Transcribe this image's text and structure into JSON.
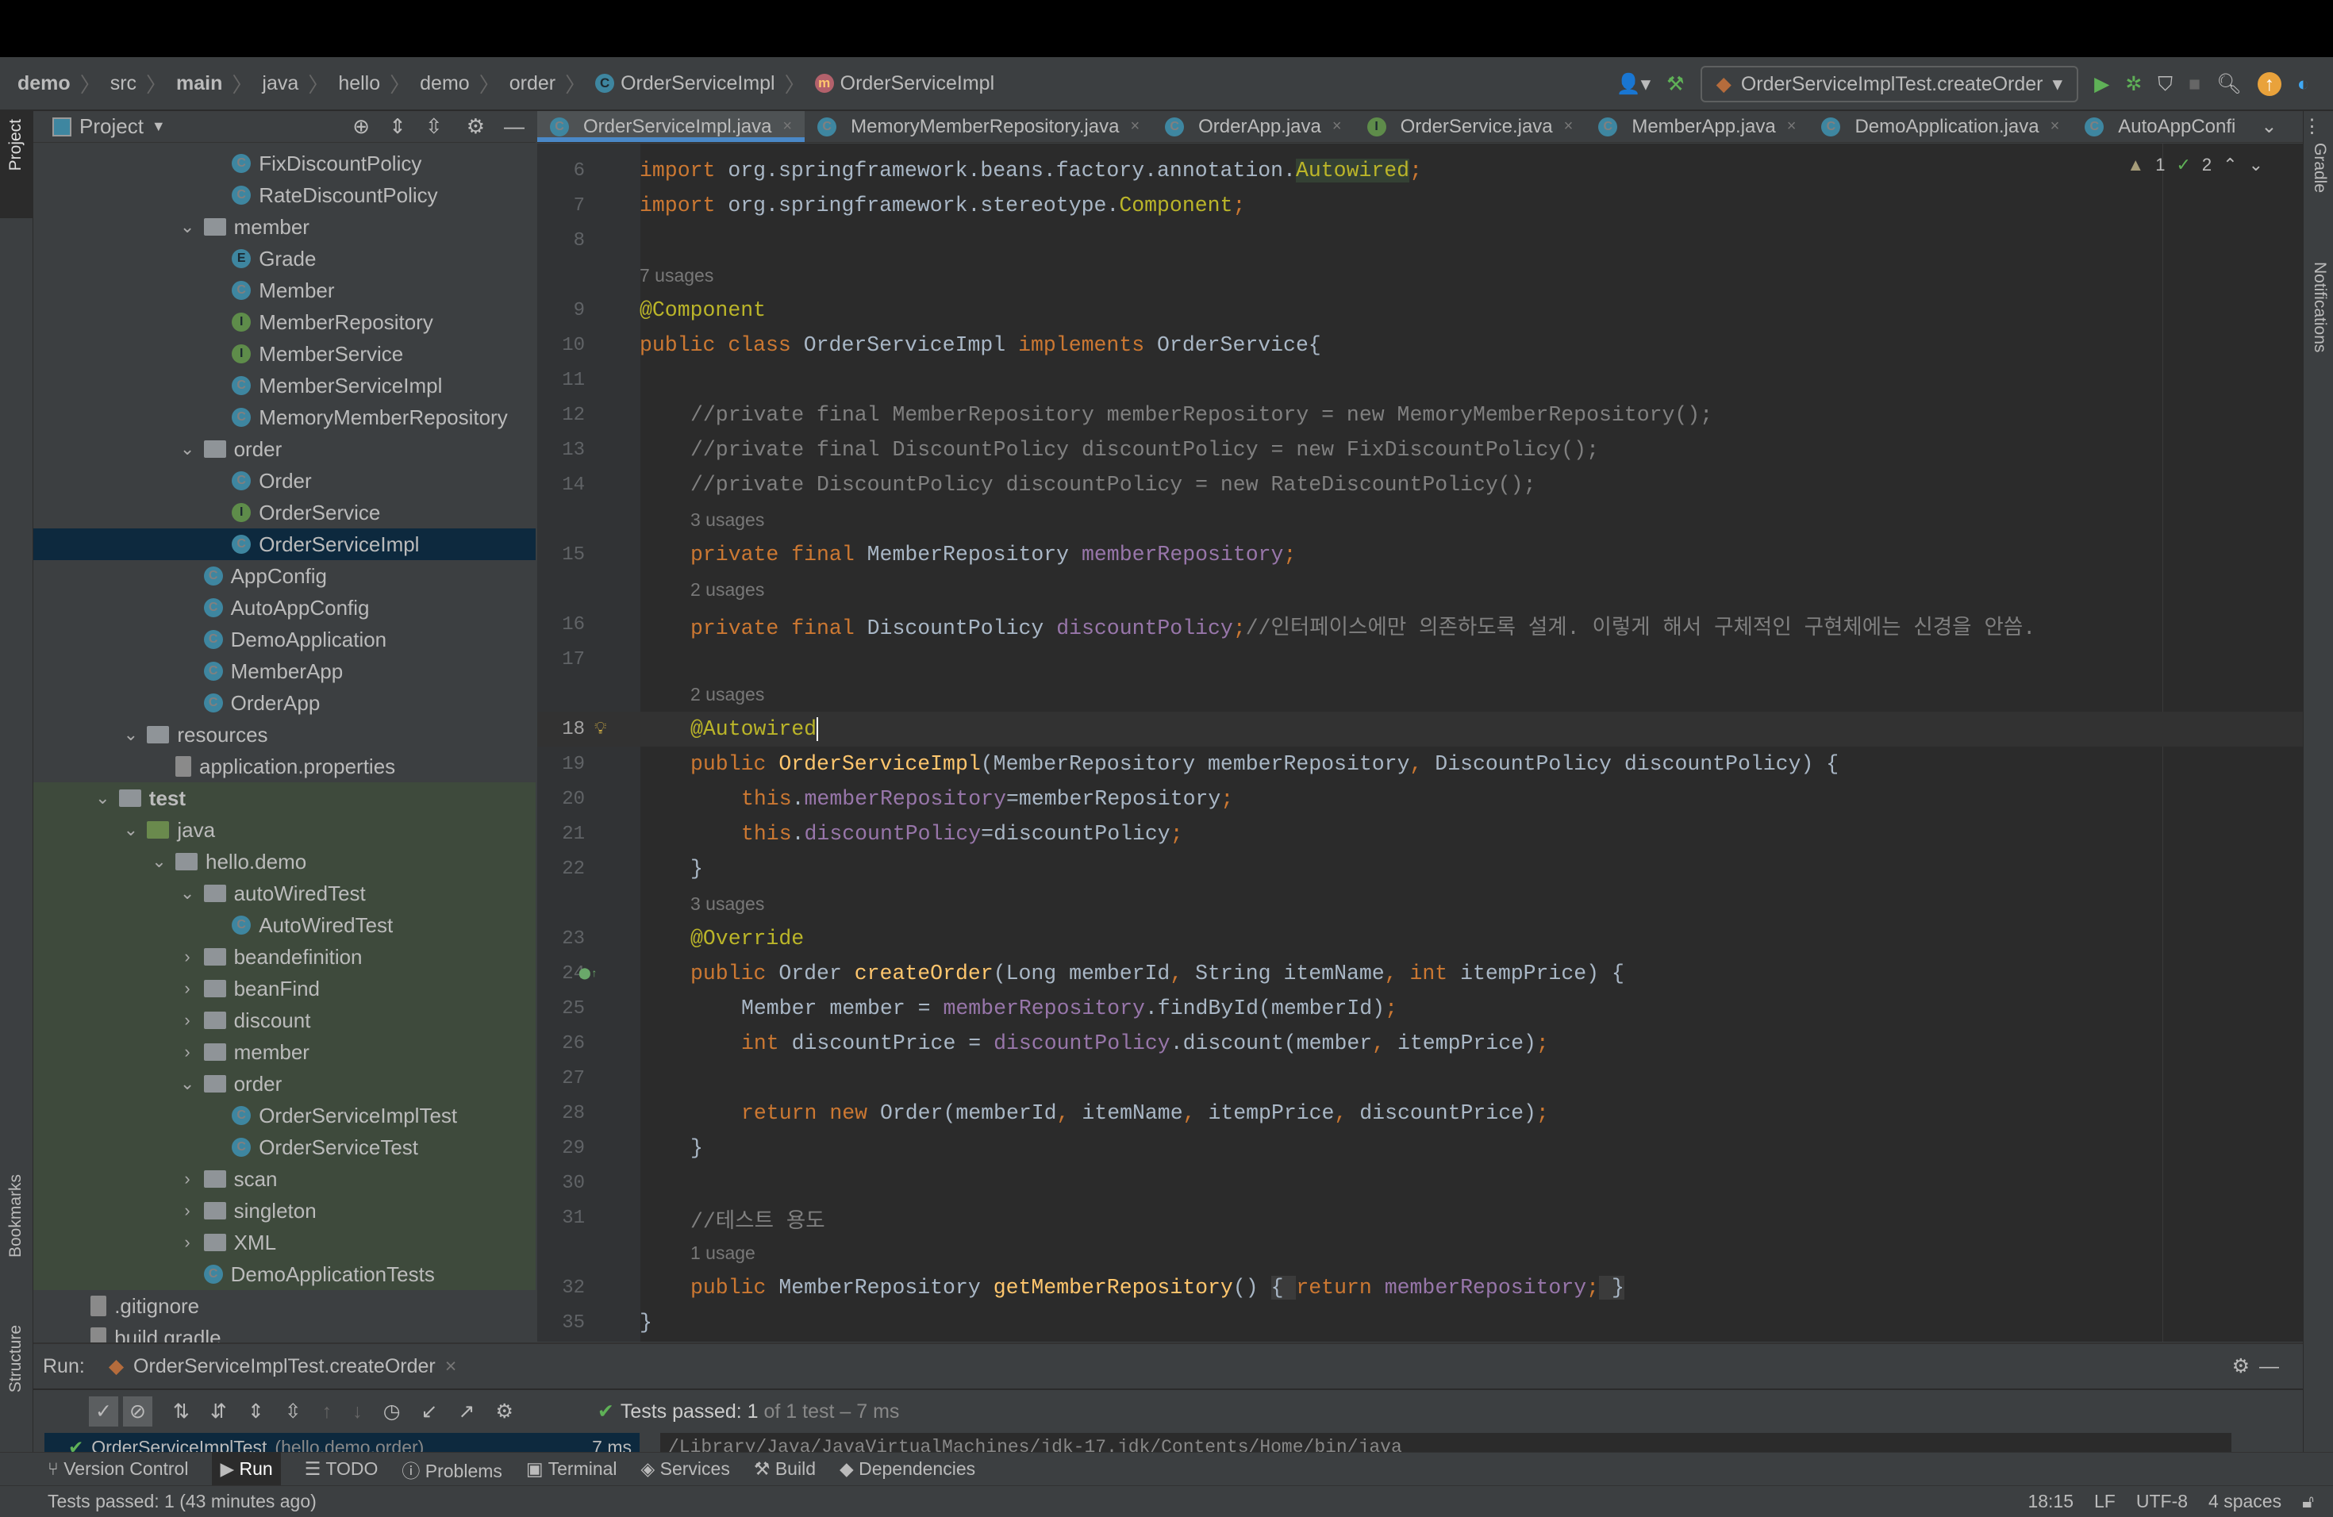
{
  "breadcrumb": [
    "demo",
    "src",
    "main",
    "java",
    "hello",
    "demo",
    "order",
    "OrderServiceImpl",
    "OrderServiceImpl"
  ],
  "run_config": "OrderServiceImplTest.createOrder",
  "project_header": "Project",
  "left_strip": {
    "project": "Project",
    "bookmarks": "Bookmarks",
    "structure": "Structure"
  },
  "right_strip": {
    "gradle": "Gradle",
    "notifications": "Notifications"
  },
  "tree": [
    {
      "l": 7,
      "t": "c",
      "label": "FixDiscountPolicy"
    },
    {
      "l": 7,
      "t": "c",
      "label": "RateDiscountPolicy"
    },
    {
      "l": 6,
      "t": "folder",
      "label": "member",
      "open": true
    },
    {
      "l": 7,
      "t": "e",
      "label": "Grade"
    },
    {
      "l": 7,
      "t": "c",
      "label": "Member"
    },
    {
      "l": 7,
      "t": "i",
      "label": "MemberRepository"
    },
    {
      "l": 7,
      "t": "i",
      "label": "MemberService"
    },
    {
      "l": 7,
      "t": "c",
      "label": "MemberServiceImpl"
    },
    {
      "l": 7,
      "t": "c",
      "label": "MemoryMemberRepository"
    },
    {
      "l": 6,
      "t": "folder",
      "label": "order",
      "open": true
    },
    {
      "l": 7,
      "t": "c",
      "label": "Order"
    },
    {
      "l": 7,
      "t": "i",
      "label": "OrderService"
    },
    {
      "l": 7,
      "t": "c",
      "label": "OrderServiceImpl",
      "sel": true
    },
    {
      "l": 6,
      "t": "c",
      "label": "AppConfig"
    },
    {
      "l": 6,
      "t": "c",
      "label": "AutoAppConfig"
    },
    {
      "l": 6,
      "t": "c",
      "label": "DemoApplication"
    },
    {
      "l": 6,
      "t": "c",
      "label": "MemberApp"
    },
    {
      "l": 6,
      "t": "c",
      "label": "OrderApp"
    },
    {
      "l": 4,
      "t": "folder",
      "label": "resources",
      "open": true
    },
    {
      "l": 5,
      "t": "file",
      "label": "application.properties"
    },
    {
      "l": 3,
      "t": "folder",
      "label": "test",
      "open": true,
      "g": true,
      "bold": true
    },
    {
      "l": 4,
      "t": "gfolder",
      "label": "java",
      "open": true,
      "g": true
    },
    {
      "l": 5,
      "t": "folder",
      "label": "hello.demo",
      "open": true,
      "g": true
    },
    {
      "l": 6,
      "t": "folder",
      "label": "autoWiredTest",
      "open": true,
      "g": true
    },
    {
      "l": 7,
      "t": "c",
      "label": "AutoWiredTest",
      "g": true
    },
    {
      "l": 6,
      "t": "folder",
      "label": "beandefinition",
      "open": false,
      "g": true
    },
    {
      "l": 6,
      "t": "folder",
      "label": "beanFind",
      "open": false,
      "g": true
    },
    {
      "l": 6,
      "t": "folder",
      "label": "discount",
      "open": false,
      "g": true
    },
    {
      "l": 6,
      "t": "folder",
      "label": "member",
      "open": false,
      "g": true
    },
    {
      "l": 6,
      "t": "folder",
      "label": "order",
      "open": true,
      "g": true
    },
    {
      "l": 7,
      "t": "c",
      "label": "OrderServiceImplTest",
      "g": true
    },
    {
      "l": 7,
      "t": "c",
      "label": "OrderServiceTest",
      "g": true
    },
    {
      "l": 6,
      "t": "folder",
      "label": "scan",
      "open": false,
      "g": true
    },
    {
      "l": 6,
      "t": "folder",
      "label": "singleton",
      "open": false,
      "g": true
    },
    {
      "l": 6,
      "t": "folder",
      "label": "XML",
      "open": false,
      "g": true
    },
    {
      "l": 6,
      "t": "c",
      "label": "DemoApplicationTests",
      "g": true
    },
    {
      "l": 2,
      "t": "file",
      "label": ".gitignore"
    },
    {
      "l": 2,
      "t": "file",
      "label": "build.gradle"
    }
  ],
  "tabs": [
    {
      "label": "OrderServiceImpl.java",
      "t": "c",
      "active": true
    },
    {
      "label": "MemoryMemberRepository.java",
      "t": "c"
    },
    {
      "label": "OrderApp.java",
      "t": "c"
    },
    {
      "label": "OrderService.java",
      "t": "i"
    },
    {
      "label": "MemberApp.java",
      "t": "c"
    },
    {
      "label": "DemoApplication.java",
      "t": "c"
    },
    {
      "label": "AutoAppConfi",
      "t": "c",
      "noclose": true
    }
  ],
  "inspections": {
    "warnings": "1",
    "typos": "2"
  },
  "code": [
    {
      "n": "6",
      "tk": [
        [
          "k",
          "import "
        ],
        [
          "d",
          "org.springframework.beans.factory.annotation."
        ],
        [
          "a hl",
          "Autowired"
        ],
        [
          "k",
          ";"
        ]
      ]
    },
    {
      "n": "7",
      "tk": [
        [
          "k",
          "import "
        ],
        [
          "d",
          "org.springframework.stereotype."
        ],
        [
          "a",
          "Component"
        ],
        [
          "k",
          ";"
        ]
      ]
    },
    {
      "n": "8",
      "tk": []
    },
    {
      "hint": "7 usages",
      "i": 0
    },
    {
      "n": "9",
      "tk": [
        [
          "a",
          "@Component"
        ]
      ]
    },
    {
      "n": "10",
      "tk": [
        [
          "k",
          "public class "
        ],
        [
          "d",
          "OrderServiceImpl "
        ],
        [
          "k",
          "implements "
        ],
        [
          "d",
          "OrderService{"
        ]
      ]
    },
    {
      "n": "11",
      "tk": []
    },
    {
      "n": "12",
      "i": 1,
      "tk": [
        [
          "c",
          "//private final MemberRepository memberRepository = new MemoryMemberRepository();"
        ]
      ]
    },
    {
      "n": "13",
      "i": 1,
      "tk": [
        [
          "c",
          "//private final DiscountPolicy discountPolicy = new FixDiscountPolicy();"
        ]
      ]
    },
    {
      "n": "14",
      "i": 1,
      "tk": [
        [
          "c",
          "//private DiscountPolicy discountPolicy = new RateDiscountPolicy();"
        ]
      ]
    },
    {
      "hint": "3 usages",
      "i": 1
    },
    {
      "n": "15",
      "i": 1,
      "tk": [
        [
          "k",
          "private final "
        ],
        [
          "d",
          "MemberRepository "
        ],
        [
          "f",
          "memberRepository"
        ],
        [
          "k",
          ";"
        ]
      ]
    },
    {
      "hint": "2 usages",
      "i": 1
    },
    {
      "n": "16",
      "i": 1,
      "tk": [
        [
          "k",
          "private final "
        ],
        [
          "d",
          "DiscountPolicy "
        ],
        [
          "f",
          "discountPolicy"
        ],
        [
          "k",
          ";"
        ],
        [
          "c",
          "//인터페이스에만 의존하도록 설계. 이렇게 해서 구체적인 구현체에는 신경을 안씀."
        ]
      ]
    },
    {
      "n": "17",
      "tk": []
    },
    {
      "hint": "2 usages",
      "i": 1
    },
    {
      "n": "18",
      "i": 1,
      "cur": true,
      "tk": [
        [
          "a",
          "@Autowired"
        ]
      ]
    },
    {
      "n": "19",
      "i": 1,
      "tk": [
        [
          "k",
          "public "
        ],
        [
          "m",
          "OrderServiceImpl"
        ],
        [
          "d",
          "(MemberRepository memberRepository"
        ],
        [
          "k",
          ", "
        ],
        [
          "d",
          "DiscountPolicy discountPolicy) {"
        ]
      ]
    },
    {
      "n": "20",
      "i": 2,
      "tk": [
        [
          "k",
          "this"
        ],
        [
          "d",
          "."
        ],
        [
          "f",
          "memberRepository"
        ],
        [
          "d",
          "=memberRepository"
        ],
        [
          "k",
          ";"
        ]
      ]
    },
    {
      "n": "21",
      "i": 2,
      "tk": [
        [
          "k",
          "this"
        ],
        [
          "d",
          "."
        ],
        [
          "f",
          "discountPolicy"
        ],
        [
          "d",
          "=discountPolicy"
        ],
        [
          "k",
          ";"
        ]
      ]
    },
    {
      "n": "22",
      "i": 1,
      "tk": [
        [
          "d",
          "}"
        ]
      ]
    },
    {
      "hint": "3 usages",
      "i": 1
    },
    {
      "n": "23",
      "i": 1,
      "tk": [
        [
          "a",
          "@Override"
        ]
      ]
    },
    {
      "n": "24",
      "i": 1,
      "tk": [
        [
          "k",
          "public "
        ],
        [
          "d",
          "Order "
        ],
        [
          "m",
          "createOrder"
        ],
        [
          "d",
          "(Long memberId"
        ],
        [
          "k",
          ", "
        ],
        [
          "d",
          "String itemName"
        ],
        [
          "k",
          ", int "
        ],
        [
          "d",
          "itempPrice) {"
        ]
      ]
    },
    {
      "n": "25",
      "i": 2,
      "tk": [
        [
          "d",
          "Member member = "
        ],
        [
          "f",
          "memberRepository"
        ],
        [
          "d",
          ".findById(memberId)"
        ],
        [
          "k",
          ";"
        ]
      ]
    },
    {
      "n": "26",
      "i": 2,
      "tk": [
        [
          "k",
          "int "
        ],
        [
          "d",
          "discountPrice = "
        ],
        [
          "f",
          "discountPolicy"
        ],
        [
          "d",
          ".discount(member"
        ],
        [
          "k",
          ", "
        ],
        [
          "d",
          "itempPrice)"
        ],
        [
          "k",
          ";"
        ]
      ]
    },
    {
      "n": "27",
      "tk": []
    },
    {
      "n": "28",
      "i": 2,
      "tk": [
        [
          "k",
          "return new "
        ],
        [
          "d",
          "Order(memberId"
        ],
        [
          "k",
          ", "
        ],
        [
          "d",
          "itemName"
        ],
        [
          "k",
          ", "
        ],
        [
          "d",
          "itempPrice"
        ],
        [
          "k",
          ", "
        ],
        [
          "d",
          "discountPrice)"
        ],
        [
          "k",
          ";"
        ]
      ]
    },
    {
      "n": "29",
      "i": 1,
      "tk": [
        [
          "d",
          "}"
        ]
      ]
    },
    {
      "n": "30",
      "tk": []
    },
    {
      "n": "31",
      "i": 1,
      "tk": [
        [
          "c",
          "//테스트 용도"
        ]
      ]
    },
    {
      "hint": "1 usage",
      "i": 1
    },
    {
      "n": "32",
      "i": 1,
      "tk": [
        [
          "k",
          "public "
        ],
        [
          "d",
          "MemberRepository "
        ],
        [
          "m",
          "getMemberRepository"
        ],
        [
          "d",
          "() "
        ],
        [
          "d br",
          "{ "
        ],
        [
          "k",
          "return "
        ],
        [
          "f",
          "memberRepository"
        ],
        [
          "k",
          ";"
        ],
        [
          "d br",
          " }"
        ]
      ]
    },
    {
      "n": "35",
      "tk": [
        [
          "d",
          "}"
        ]
      ]
    }
  ],
  "run": {
    "label": "Run:",
    "config": "OrderServiceImplTest.createOrder",
    "tests_passed": "Tests passed: 1",
    "tests_detail": " of 1 test – 7 ms",
    "tree_row": "OrderServiceImplTest",
    "tree_pkg": " (hello.demo.order)",
    "tree_time": "7 ms",
    "console": "/Library/Java/JavaVirtualMachines/jdk-17.jdk/Contents/Home/bin/java"
  },
  "bottom_tools": [
    "Version Control",
    "Run",
    "TODO",
    "Problems",
    "Terminal",
    "Services",
    "Build",
    "Dependencies"
  ],
  "status": {
    "message": "Tests passed: 1 (43 minutes ago)",
    "position": "18:15",
    "line_sep": "LF",
    "encoding": "UTF-8",
    "indent": "4 spaces"
  },
  "colors": {
    "accent": "#4a88c7",
    "keyword": "#cc7832",
    "annotation": "#bbb529",
    "field": "#9876aa",
    "method": "#ffc66d",
    "success": "#5fb157"
  }
}
